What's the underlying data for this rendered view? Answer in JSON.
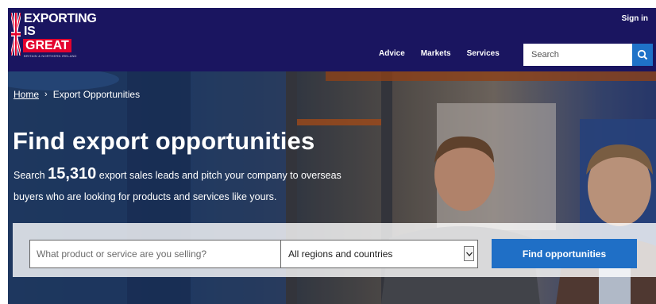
{
  "brand": {
    "line1": "EXPORTING",
    "line2": "IS",
    "line3": "GREAT",
    "subline": "BRITAIN & NORTHERN IRELAND"
  },
  "header": {
    "signin": "Sign in",
    "nav": [
      "Advice",
      "Markets",
      "Services"
    ],
    "search_placeholder": "Search"
  },
  "breadcrumb": {
    "home": "Home",
    "separator": "›",
    "current": "Export Opportunities"
  },
  "hero": {
    "title": "Find export opportunities",
    "intro_before": "Search",
    "count": "15,310",
    "intro_after": "export sales leads and pitch your company to overseas buyers who are looking for products and services like yours."
  },
  "search_form": {
    "product_placeholder": "What product or service are you selling?",
    "region_value": "All regions and countries",
    "submit_label": "Find opportunities"
  },
  "colors": {
    "header_bg": "#1a1560",
    "brand_red": "#e4032e",
    "button_blue": "#1f6fc6"
  }
}
